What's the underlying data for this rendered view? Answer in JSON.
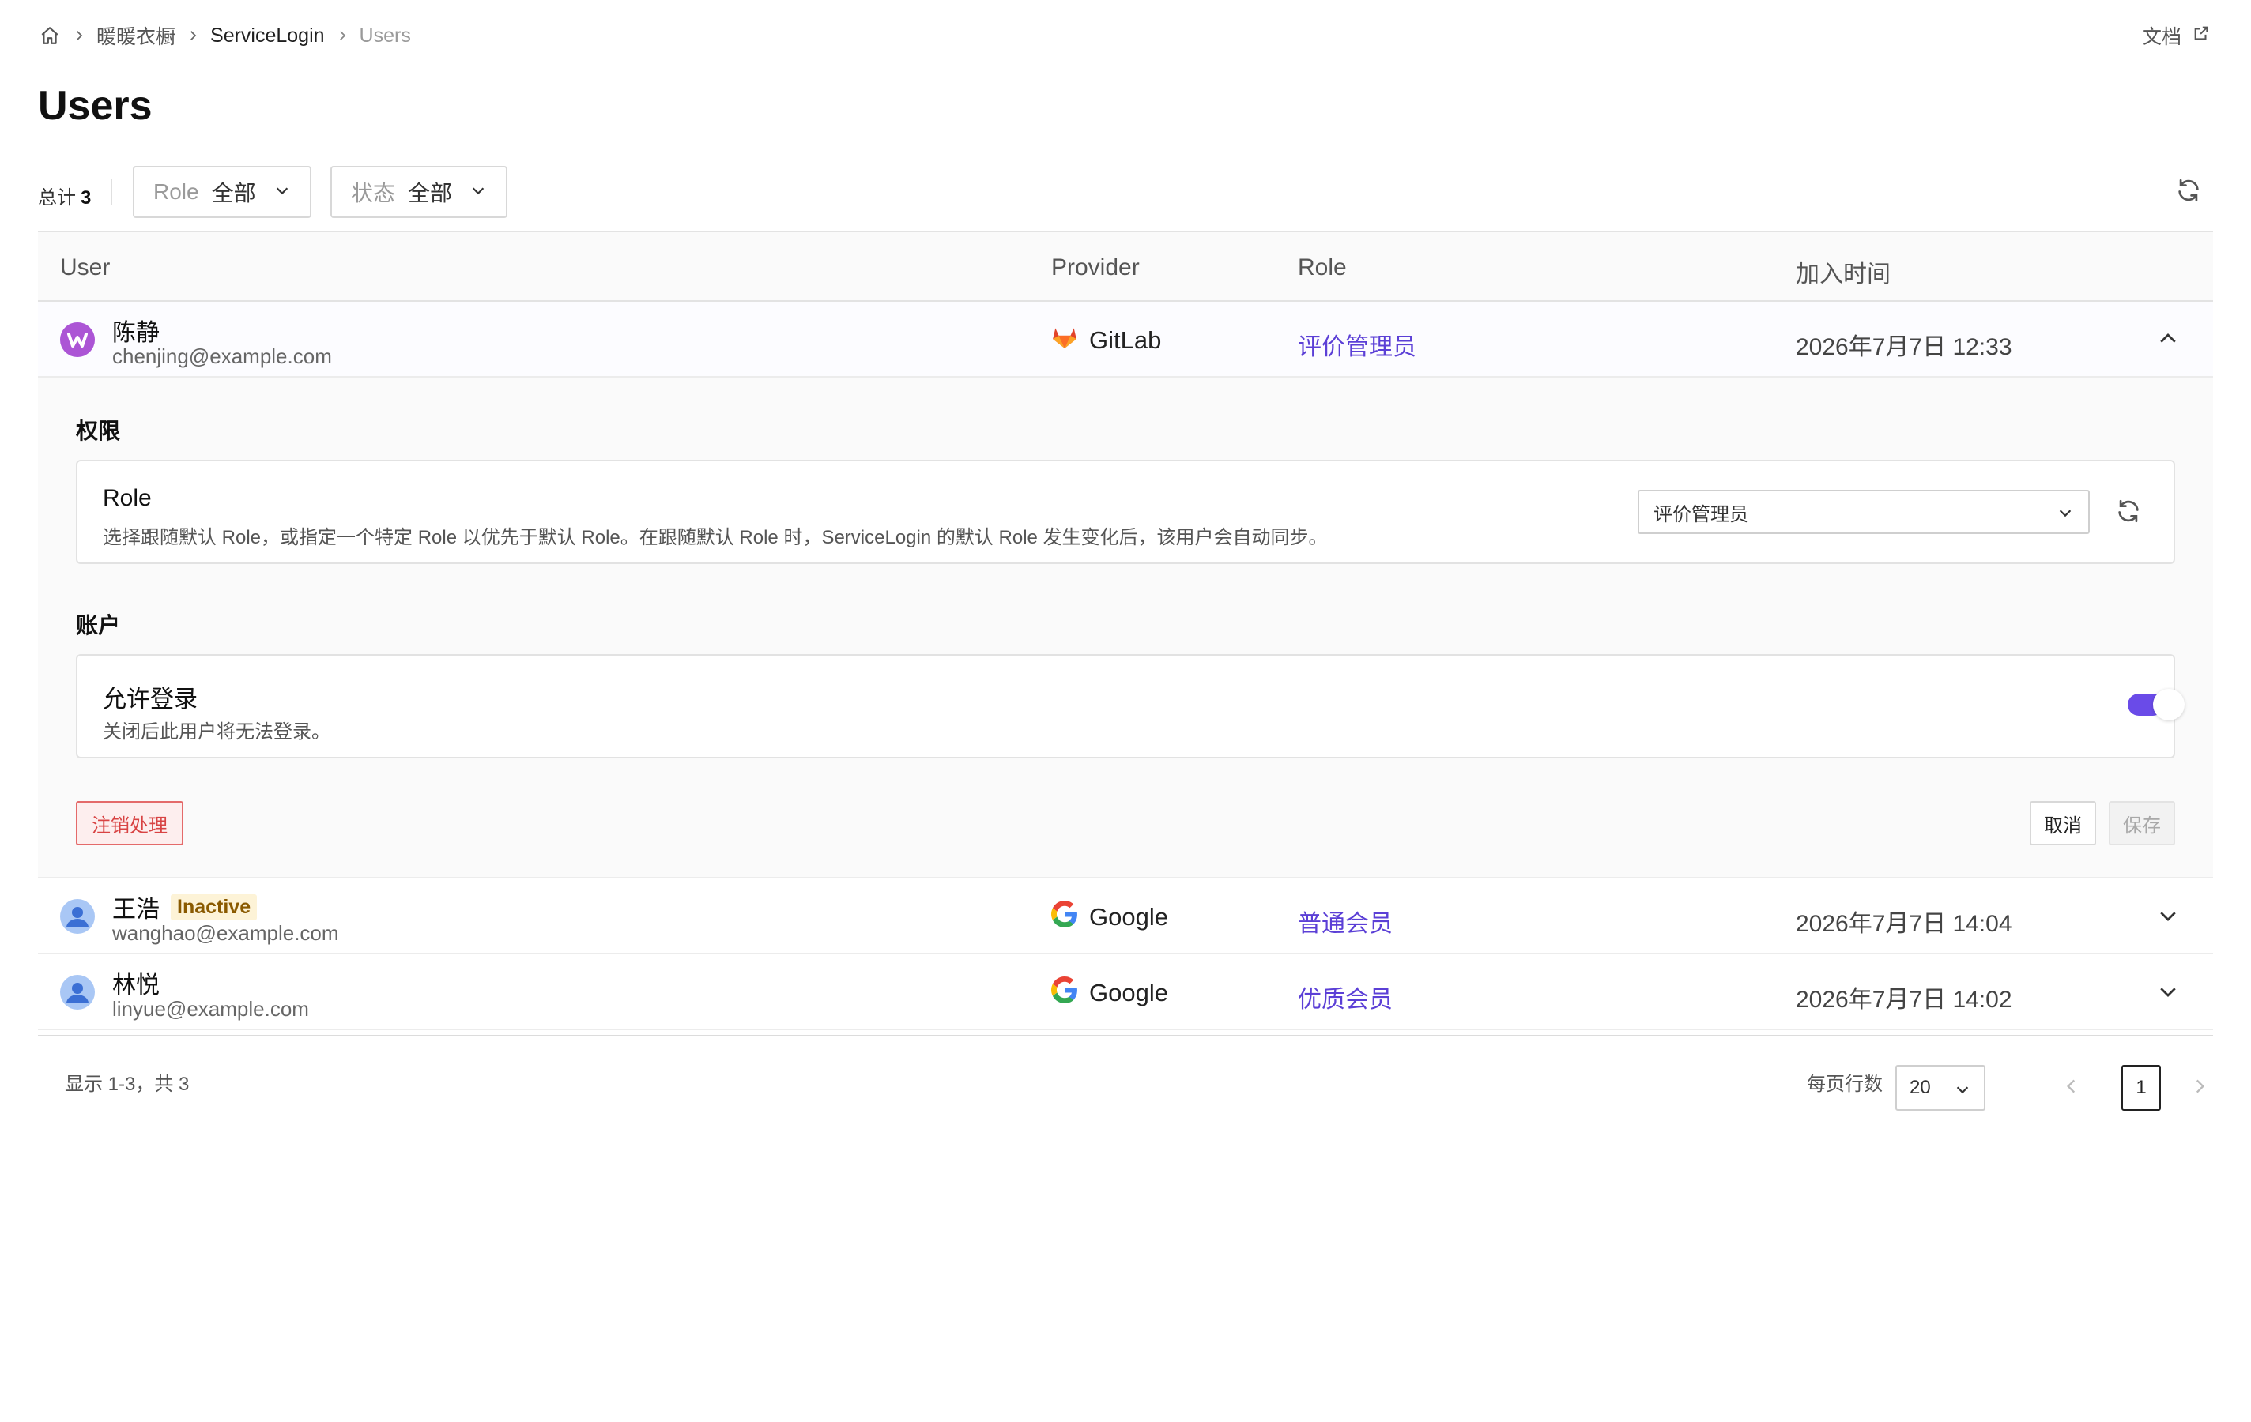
{
  "breadcrumb": {
    "items": [
      "暖暖衣橱",
      "ServiceLogin",
      "Users"
    ]
  },
  "docs_link": "文档",
  "page_title": "Users",
  "filters": {
    "total_label": "总计",
    "total_count": "3",
    "role_label": "Role",
    "role_value": "全部",
    "status_label": "状态",
    "status_value": "全部"
  },
  "table": {
    "headers": [
      "User",
      "Provider",
      "Role",
      "加入时间"
    ],
    "rows": [
      {
        "name": "陈静",
        "email": "chenjing@example.com",
        "provider": "GitLab",
        "role": "评价管理员",
        "joined": "2026年7月7日 12:33",
        "badge": ""
      },
      {
        "name": "王浩",
        "email": "wanghao@example.com",
        "provider": "Google",
        "role": "普通会员",
        "joined": "2026年7月7日 14:04",
        "badge": "Inactive"
      },
      {
        "name": "林悦",
        "email": "linyue@example.com",
        "provider": "Google",
        "role": "优质会员",
        "joined": "2026年7月7日 14:02",
        "badge": ""
      }
    ]
  },
  "detail": {
    "permissions_title": "权限",
    "role_card_title": "Role",
    "role_card_desc": "选择跟随默认 Role，或指定一个特定 Role 以优先于默认 Role。在跟随默认 Role 时，ServiceLogin 的默认 Role 发生变化后，该用户会自动同步。",
    "role_select_value": "评价管理员",
    "account_title": "账户",
    "login_card_title": "允许登录",
    "login_card_desc": "关闭后此用户将无法登录。",
    "allow_login": true,
    "deactivate_label": "注销处理",
    "cancel_label": "取消",
    "save_label": "保存"
  },
  "pagination": {
    "range_text": "显示 1-3，共 3",
    "rows_per_page_label": "每页行数",
    "rows_per_page": "20",
    "current_page": "1"
  },
  "colors": {
    "accent": "#6a4be8",
    "role_link": "#5b3fd6",
    "danger": "#d84343",
    "badge_bg": "#fdf3d7"
  },
  "icons": {
    "home": "home-icon",
    "breadcrumb_separator": "chevron-right-icon",
    "docs": "external-link-icon",
    "refresh": "refresh-icon",
    "gitlab": "gitlab-icon",
    "google": "google-icon",
    "expand": "chevron-down-icon",
    "collapse": "chevron-up-icon"
  }
}
